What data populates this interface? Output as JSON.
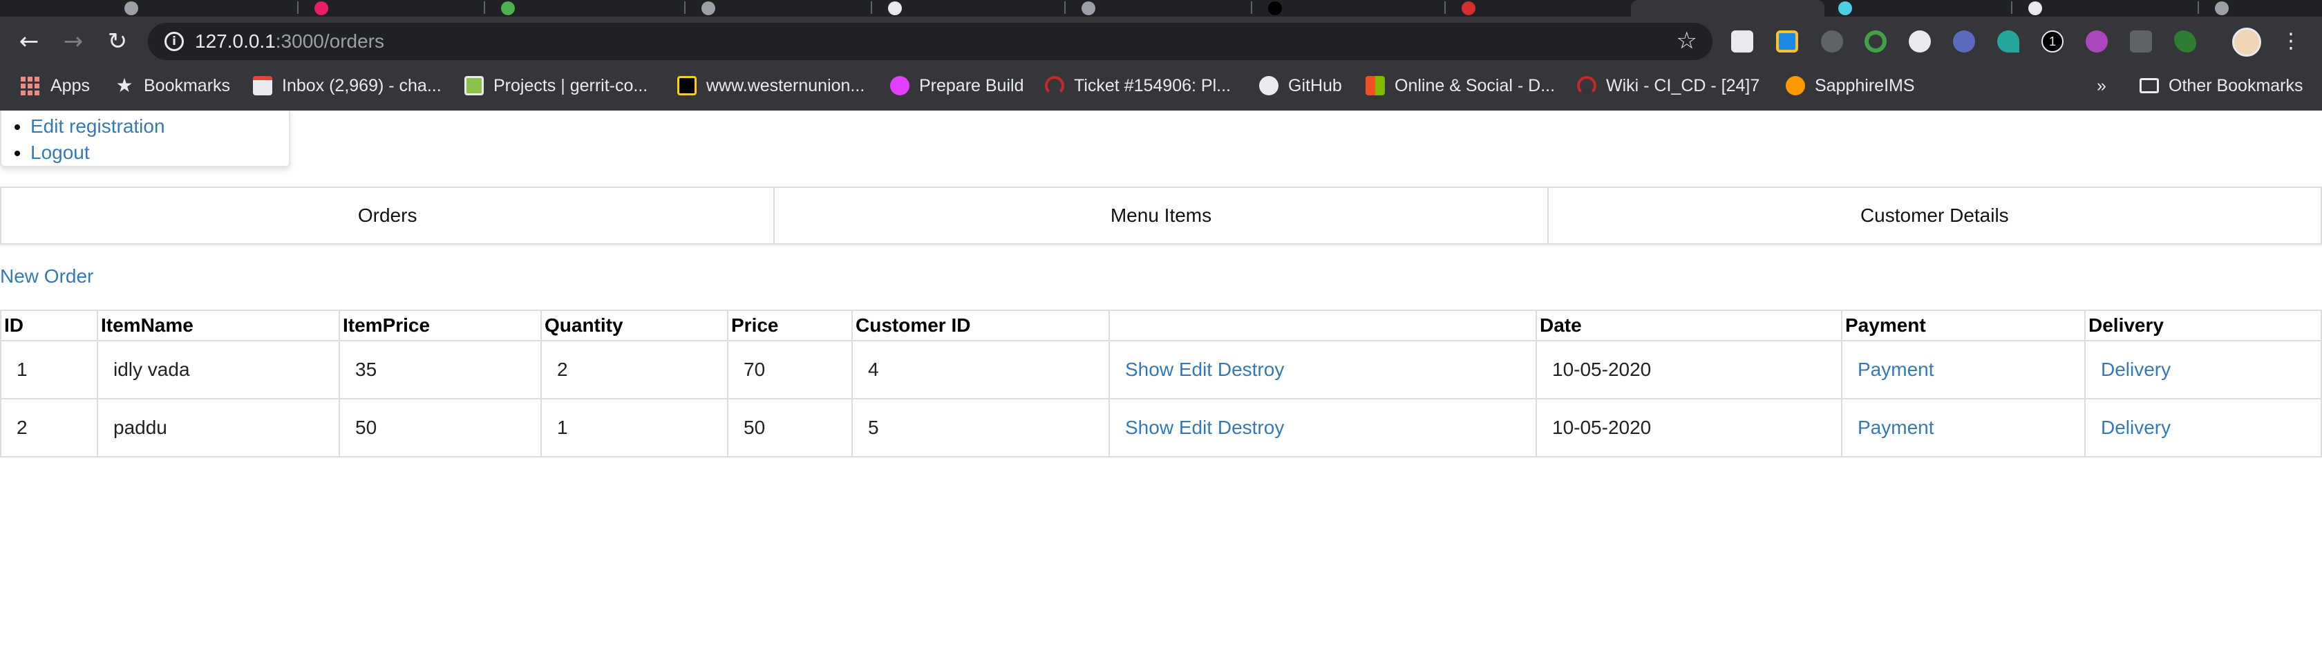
{
  "browser": {
    "url_host": "127.0.0.1",
    "url_path": ":3000/orders",
    "extension_badge": "1",
    "bookmarks_overflow": "»"
  },
  "bookmarks": [
    {
      "label": "Apps",
      "icon": "apps-grid-icon"
    },
    {
      "label": "Bookmarks",
      "icon": "star-icon"
    },
    {
      "label": "Inbox (2,969) - cha...",
      "icon": "gmail-icon"
    },
    {
      "label": "Projects | gerrit-co...",
      "icon": "gerrit-icon"
    },
    {
      "label": "www.westernunion...",
      "icon": "westernunion-icon"
    },
    {
      "label": "Prepare Build",
      "icon": "hop-icon"
    },
    {
      "label": "Ticket #154906: Pl...",
      "icon": "ticket-icon"
    },
    {
      "label": "GitHub",
      "icon": "github-icon"
    },
    {
      "label": "Online & Social - D...",
      "icon": "microsoft-icon"
    },
    {
      "label": "Wiki - CI_CD - [24]7",
      "icon": "wiki-icon"
    },
    {
      "label": "SapphireIMS",
      "icon": "sapphire-icon"
    },
    {
      "label": "Other Bookmarks",
      "icon": "folder-icon"
    }
  ],
  "user_menu": {
    "items": [
      "Edit registration",
      "Logout"
    ]
  },
  "nav_tabs": [
    "Orders",
    "Menu Items",
    "Customer Details"
  ],
  "new_order_label": "New Order",
  "table": {
    "headers": [
      "ID",
      "ItemName",
      "ItemPrice",
      "Quantity",
      "Price",
      "Customer ID",
      "",
      "Date",
      "Payment",
      "Delivery"
    ],
    "rows": [
      {
        "id": "1",
        "item_name": "idly vada",
        "item_price": "35",
        "quantity": "2",
        "price": "70",
        "customer_id": "4",
        "show": "Show",
        "edit": "Edit",
        "destroy": "Destroy",
        "date": "10-05-2020",
        "payment": "Payment",
        "delivery": "Delivery"
      },
      {
        "id": "2",
        "item_name": "paddu",
        "item_price": "50",
        "quantity": "1",
        "price": "50",
        "customer_id": "5",
        "show": "Show",
        "edit": "Edit",
        "destroy": "Destroy",
        "date": "10-05-2020",
        "payment": "Payment",
        "delivery": "Delivery"
      }
    ]
  },
  "colors": {
    "link": "#337ab7",
    "chrome_bg": "#35363a",
    "omnibox_bg": "#202124"
  }
}
